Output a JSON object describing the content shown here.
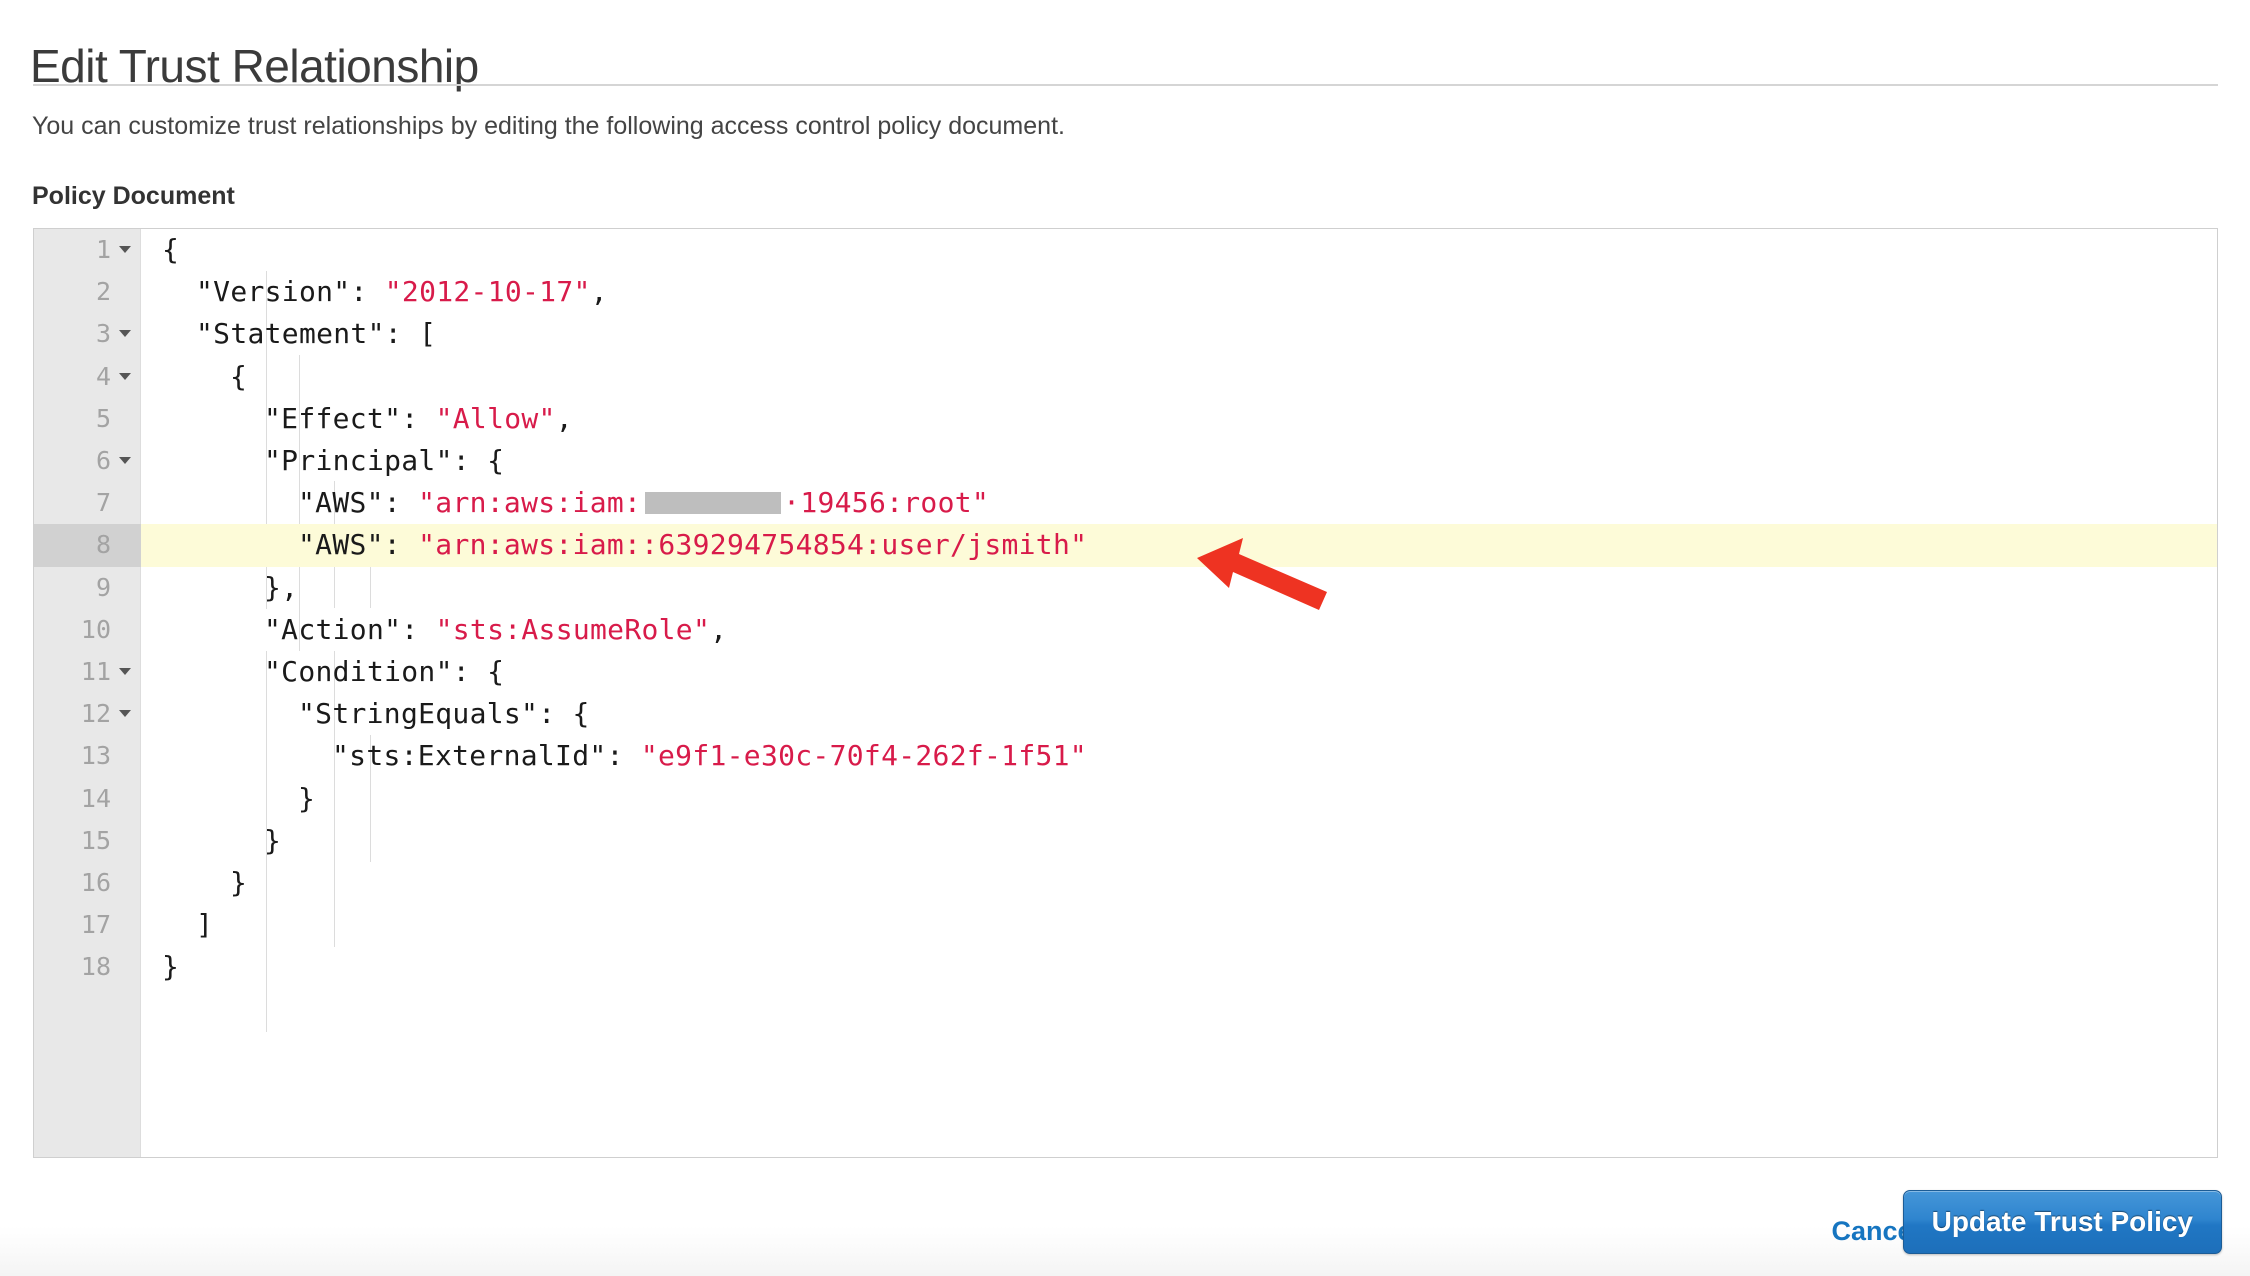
{
  "header": {
    "title": "Edit Trust Relationship",
    "description": "You can customize trust relationships by editing the following access control policy document.",
    "field_label": "Policy Document"
  },
  "editor": {
    "active_line": 8,
    "highlight_color": "#fdfbd8",
    "gutter_color": "#e8e8e8",
    "active_gutter_color": "#d1d1d1",
    "string_color": "#d81b4a",
    "text_color": "#1a1a1a",
    "lines": [
      {
        "n": "1",
        "fold": true,
        "indent": 0,
        "text": "{"
      },
      {
        "n": "2",
        "fold": false,
        "indent": 1,
        "text": "\"Version\": \"2012-10-17\","
      },
      {
        "n": "3",
        "fold": true,
        "indent": 1,
        "text": "\"Statement\": ["
      },
      {
        "n": "4",
        "fold": true,
        "indent": 2,
        "text": "{"
      },
      {
        "n": "5",
        "fold": false,
        "indent": 3,
        "text": "\"Effect\": \"Allow\","
      },
      {
        "n": "6",
        "fold": true,
        "indent": 3,
        "text": "\"Principal\": {"
      },
      {
        "n": "7",
        "fold": false,
        "indent": 4,
        "text": "\"AWS\": \"arn:aws:iam: [REDACTED] ·19456:root\""
      },
      {
        "n": "8",
        "fold": false,
        "indent": 4,
        "text": "\"AWS\": \"arn:aws:iam::639294754854:user/jsmith\""
      },
      {
        "n": "9",
        "fold": false,
        "indent": 3,
        "text": "},"
      },
      {
        "n": "10",
        "fold": false,
        "indent": 3,
        "text": "\"Action\": \"sts:AssumeRole\","
      },
      {
        "n": "11",
        "fold": true,
        "indent": 3,
        "text": "\"Condition\": {"
      },
      {
        "n": "12",
        "fold": true,
        "indent": 4,
        "text": "\"StringEquals\": {"
      },
      {
        "n": "13",
        "fold": false,
        "indent": 5,
        "text": "\"sts:ExternalId\": \"e9f1-e30c-70f4-262f-1f51\""
      },
      {
        "n": "14",
        "fold": false,
        "indent": 4,
        "text": "}"
      },
      {
        "n": "15",
        "fold": false,
        "indent": 3,
        "text": "}"
      },
      {
        "n": "16",
        "fold": false,
        "indent": 2,
        "text": "}"
      },
      {
        "n": "17",
        "fold": false,
        "indent": 1,
        "text": "]"
      },
      {
        "n": "18",
        "fold": false,
        "indent": 0,
        "text": "}"
      }
    ],
    "tokens": {
      "l1": {
        "pun": "{"
      },
      "l2": {
        "key": "\"Version\"",
        "colon": ": ",
        "val": "\"2012-10-17\"",
        "end": ","
      },
      "l3": {
        "key": "\"Statement\"",
        "colon": ": ",
        "val": "["
      },
      "l4": {
        "pun": "{"
      },
      "l5": {
        "key": "\"Effect\"",
        "colon": ": ",
        "val": "\"Allow\"",
        "end": ","
      },
      "l6": {
        "key": "\"Principal\"",
        "colon": ": ",
        "val": "{"
      },
      "l7": {
        "key": "\"AWS\"",
        "colon": ": ",
        "pre": "\"arn:aws:iam:",
        "post": "·19456:root\""
      },
      "l8": {
        "key": "\"AWS\"",
        "colon": ": ",
        "val": "\"arn:aws:iam::639294754854:user/jsmith\""
      },
      "l9": {
        "pun": "},"
      },
      "l10": {
        "key": "\"Action\"",
        "colon": ": ",
        "val": "\"sts:AssumeRole\"",
        "end": ","
      },
      "l11": {
        "key": "\"Condition\"",
        "colon": ": ",
        "val": "{"
      },
      "l12": {
        "key": "\"StringEquals\"",
        "colon": ": ",
        "val": "{"
      },
      "l13": {
        "key": "\"sts:ExternalId\"",
        "colon": ": ",
        "val": "\"e9f1-e30c-70f4-262f-1f51\""
      },
      "l14": {
        "pun": "}"
      },
      "l15": {
        "pun": "}"
      },
      "l16": {
        "pun": "}"
      },
      "l17": {
        "pun": "]"
      },
      "l18": {
        "pun": "}"
      }
    }
  },
  "annotation": {
    "arrow_color": "#ee3322",
    "points_to_line": "8"
  },
  "footer": {
    "cancel_label": "Cancel",
    "submit_label": "Update Trust Policy",
    "cancel_color": "#1675c0",
    "submit_color": "#2077c4"
  }
}
